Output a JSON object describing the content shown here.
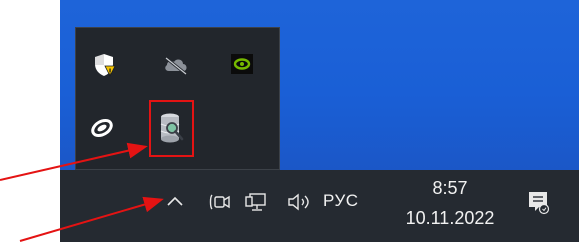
{
  "tray_flyout": {
    "icons": [
      {
        "name": "security-warning-icon",
        "tooltip": ""
      },
      {
        "name": "onedrive-offline-icon",
        "tooltip": ""
      },
      {
        "name": "nvidia-icon",
        "tooltip": ""
      },
      {
        "name": "app-ring-icon",
        "tooltip": ""
      },
      {
        "name": "database-search-icon",
        "tooltip": ""
      }
    ]
  },
  "taskbar": {
    "language": "РУС",
    "time": "8:57",
    "date": "10.11.2022",
    "icons": [
      "show-hidden-icons-chevron",
      "meet-now-icon",
      "network-icon",
      "volume-icon",
      "notifications-icon"
    ]
  },
  "colors": {
    "desktop_blue": "#1e64d9",
    "taskbar_bg": "#252a31",
    "flyout_bg": "#22262c",
    "annotation_red": "#e41313"
  }
}
